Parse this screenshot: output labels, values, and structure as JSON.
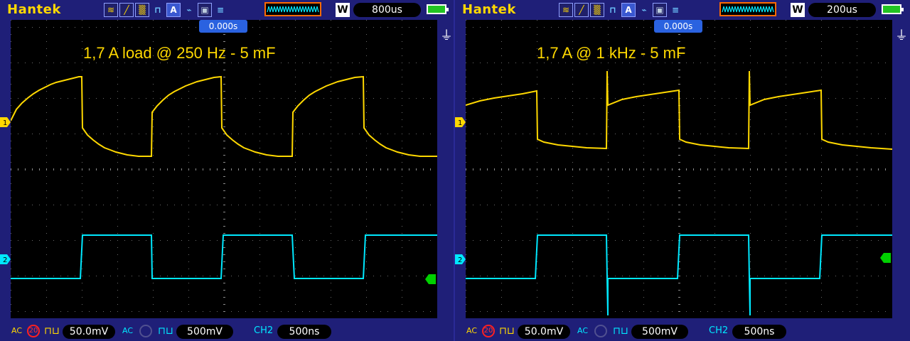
{
  "scopes": [
    {
      "brand": "Hantek",
      "mode_label": "W",
      "timebase": "800us",
      "trigger_position": "0.000s",
      "annotation": "1,7 A load @ 250 Hz - 5 mF",
      "ch1": {
        "coupling": "AC",
        "bw_limit": "20",
        "scale": "50.0mV"
      },
      "ch2": {
        "coupling": "AC",
        "scale": "500mV"
      },
      "trigger": {
        "source": "CH2",
        "value": "500ns"
      },
      "ch1_marker": "1",
      "ch2_marker": "2"
    },
    {
      "brand": "Hantek",
      "mode_label": "W",
      "timebase": "200us",
      "trigger_position": "0.000s",
      "annotation": "1,7 A @ 1 kHz - 5 mF",
      "ch1": {
        "coupling": "AC",
        "bw_limit": "20",
        "scale": "50.0mV"
      },
      "ch2": {
        "coupling": "AC",
        "scale": "500mV"
      },
      "trigger": {
        "source": "CH2",
        "value": "500ns"
      },
      "ch1_marker": "1",
      "ch2_marker": "2"
    }
  ],
  "icons": [
    "waveform-icon",
    "ref-wave-icon",
    "math-wave-icon",
    "square-wave-icon",
    "auto-measure-icon",
    "probe-icon",
    "save-icon",
    "menu-icon",
    "trigger-memory-icon",
    "battery-icon",
    "power-plug-icon"
  ],
  "colors": {
    "ch1": "#ffd800",
    "ch2": "#00e8ff",
    "trigger_level": "#00d000",
    "background": "#1f1f78",
    "screen": "#000000",
    "trigger_box": "#ff6a00"
  }
}
